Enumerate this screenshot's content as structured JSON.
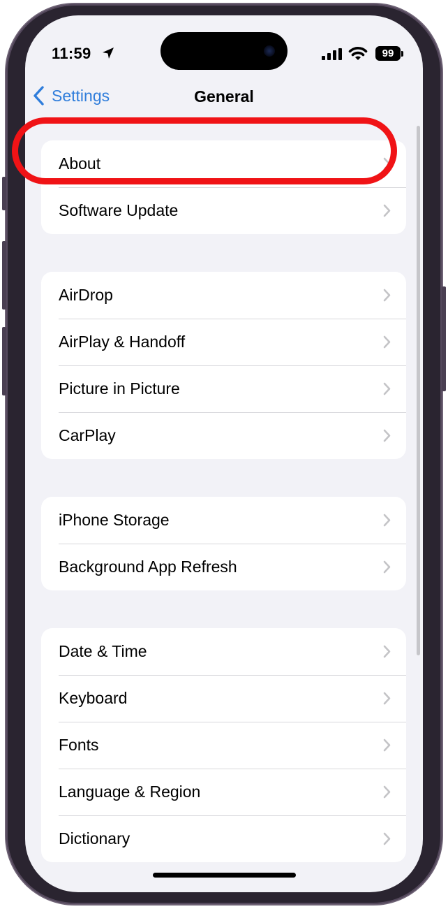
{
  "status_bar": {
    "time": "11:59",
    "location_icon": "location-arrow-icon",
    "battery": "99"
  },
  "nav": {
    "back_label": "Settings",
    "title": "General"
  },
  "groups": [
    {
      "items": [
        {
          "label": "About",
          "highlighted": true
        },
        {
          "label": "Software Update"
        }
      ]
    },
    {
      "items": [
        {
          "label": "AirDrop"
        },
        {
          "label": "AirPlay & Handoff"
        },
        {
          "label": "Picture in Picture"
        },
        {
          "label": "CarPlay"
        }
      ]
    },
    {
      "items": [
        {
          "label": "iPhone Storage"
        },
        {
          "label": "Background App Refresh"
        }
      ]
    },
    {
      "items": [
        {
          "label": "Date & Time"
        },
        {
          "label": "Keyboard"
        },
        {
          "label": "Fonts"
        },
        {
          "label": "Language & Region"
        },
        {
          "label": "Dictionary"
        }
      ]
    }
  ],
  "colors": {
    "accent": "#2f7ddb",
    "highlight": "#f01316",
    "background": "#f2f2f7"
  }
}
